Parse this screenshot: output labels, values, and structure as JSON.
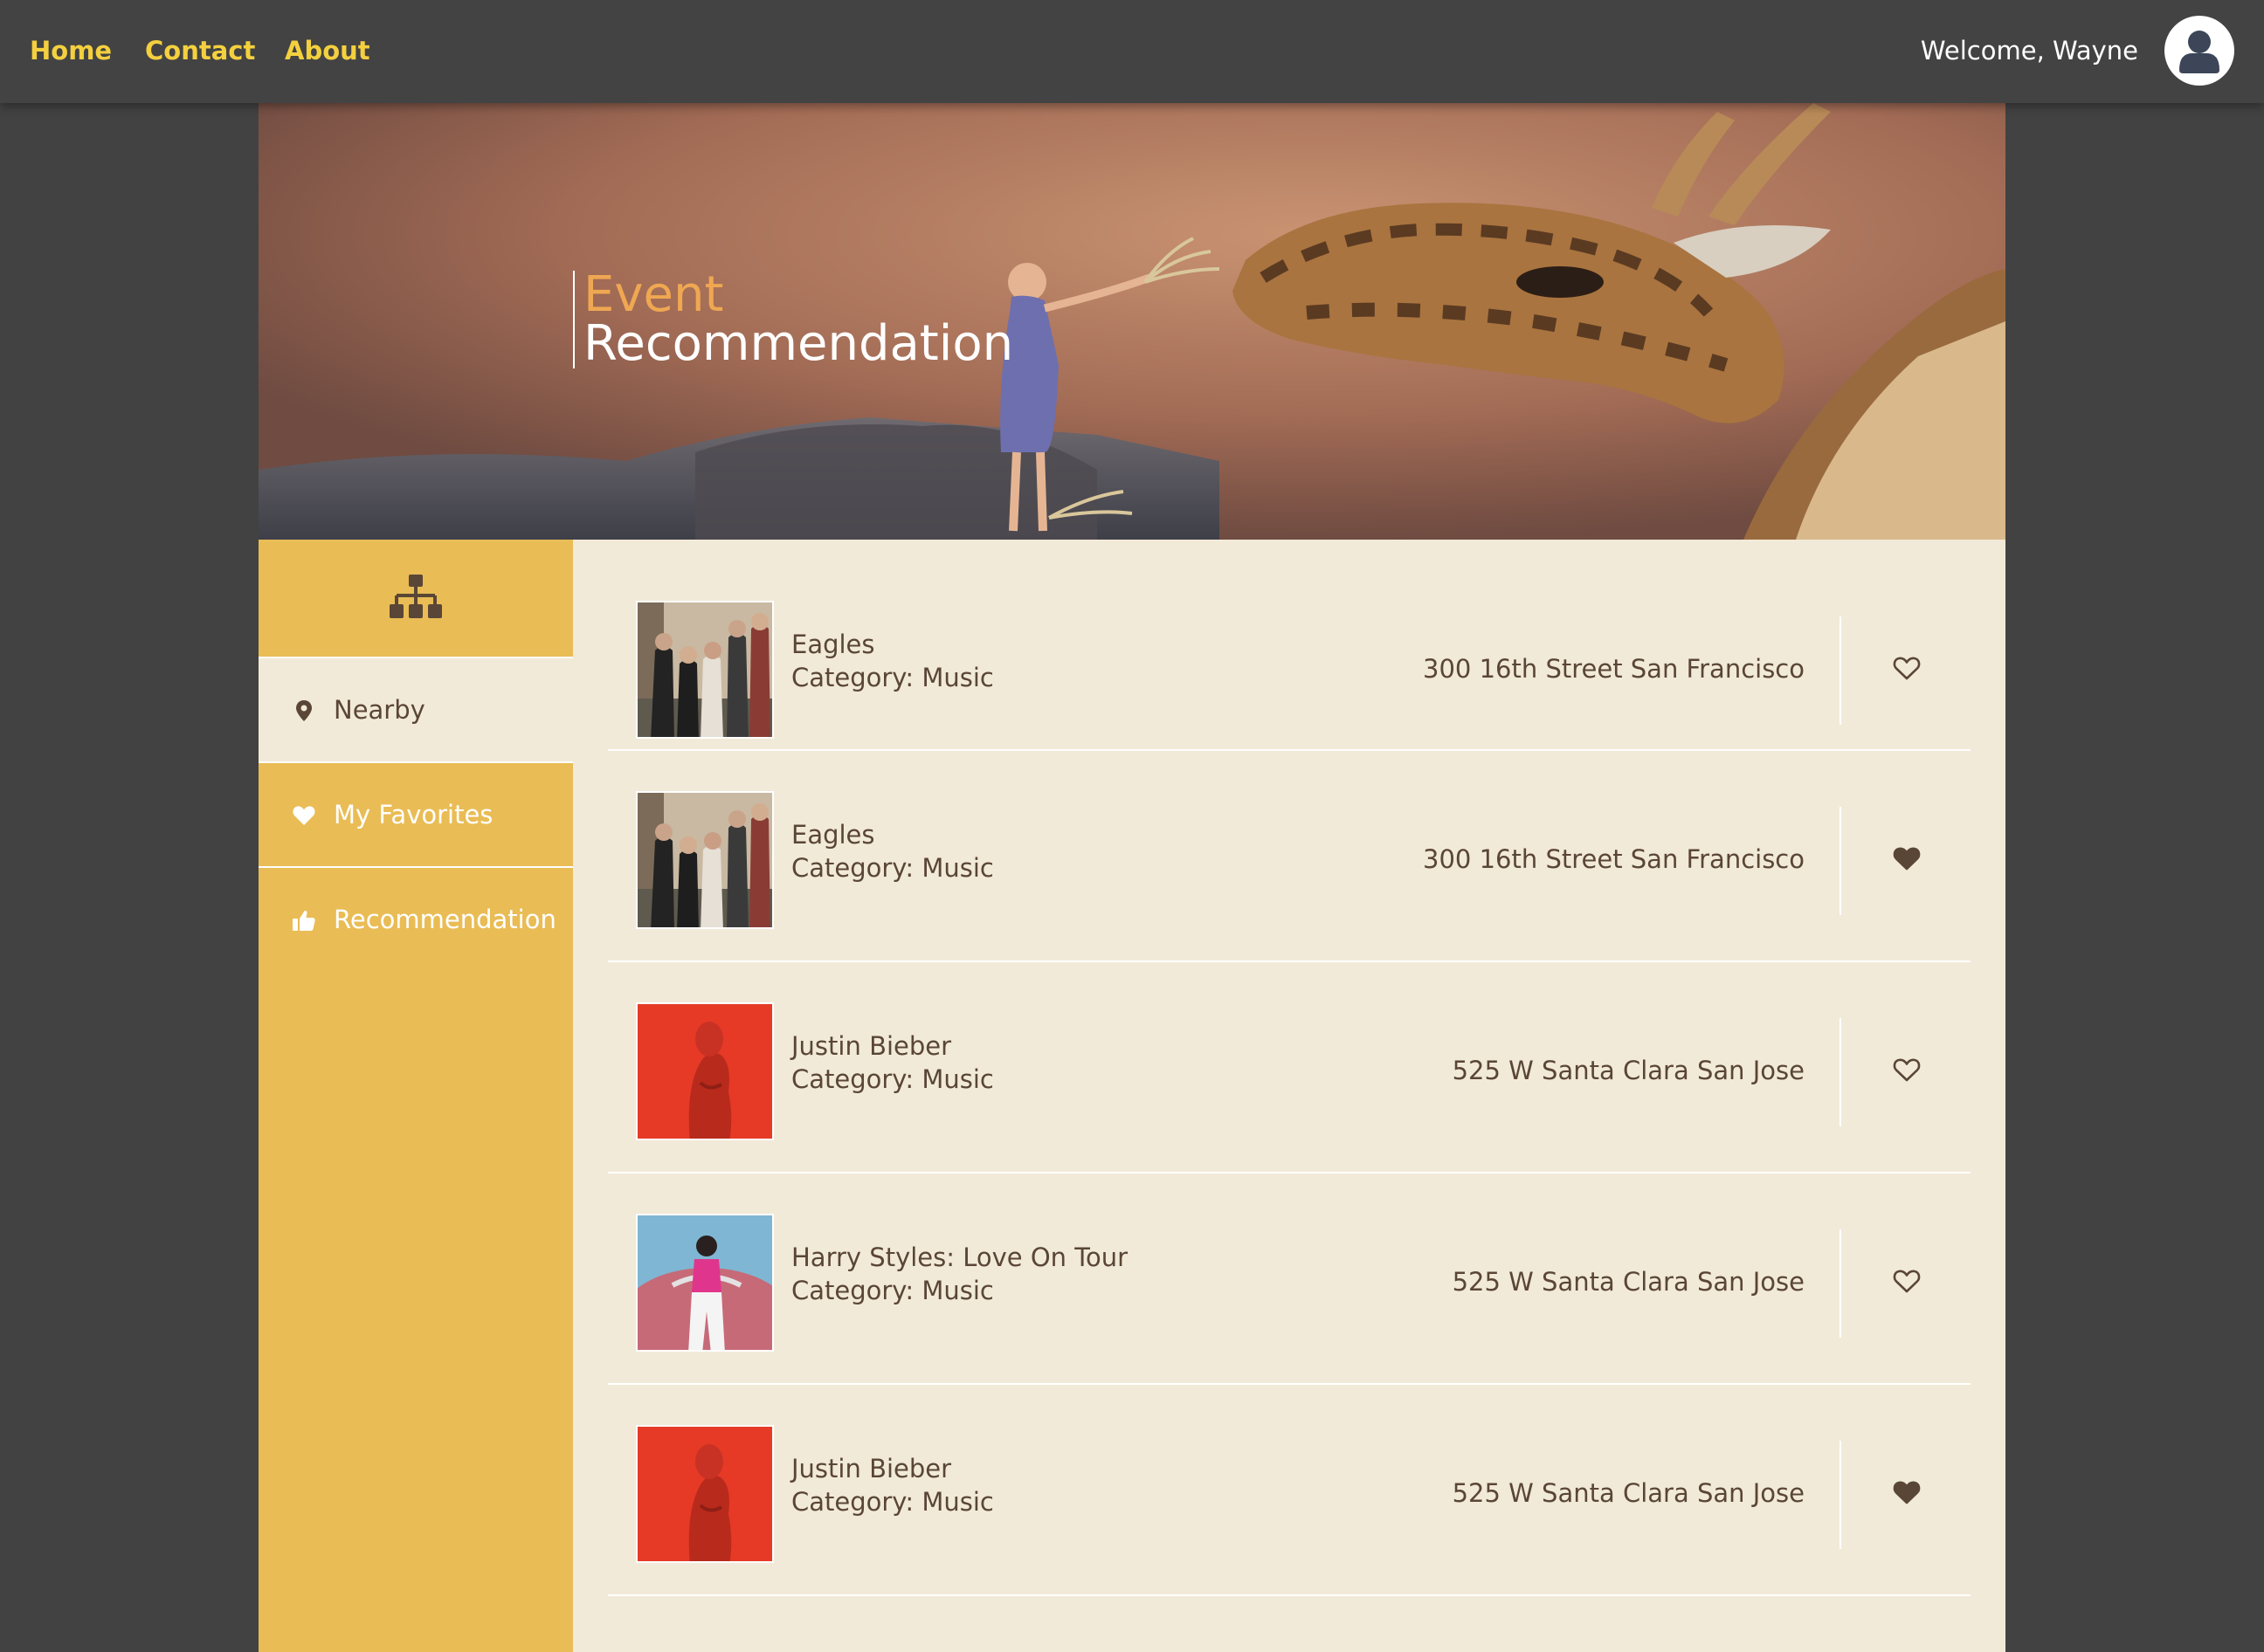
{
  "nav": {
    "home": "Home",
    "contact": "Contact",
    "about": "About",
    "welcome": "Welcome, Wayne"
  },
  "hero": {
    "title_line1": "Event",
    "title_line2": "Recommendation"
  },
  "sidebar": {
    "header_icon": "sitemap-icon",
    "items": [
      {
        "label": "Nearby",
        "icon": "map-pin-icon",
        "active": true
      },
      {
        "label": "My Favorites",
        "icon": "heart-icon",
        "active": false
      },
      {
        "label": "Recommendation",
        "icon": "thumbs-up-icon",
        "active": false
      }
    ]
  },
  "events": [
    {
      "name": "Eagles",
      "category": "Category: Music",
      "address": "300 16th Street San Francisco",
      "favorited": false
    },
    {
      "name": "Eagles",
      "category": "Category: Music",
      "address": "300 16th Street San Francisco",
      "favorited": true
    },
    {
      "name": "Justin Bieber",
      "category": "Category: Music",
      "address": "525 W Santa Clara San Jose",
      "favorited": false
    },
    {
      "name": "Harry Styles: Love On Tour",
      "category": "Category: Music",
      "address": "525 W Santa Clara San Jose",
      "favorited": false
    },
    {
      "name": "Justin Bieber",
      "category": "Category: Music",
      "address": "525 W Santa Clara San Jose",
      "favorited": true
    }
  ],
  "colors": {
    "nav_bg": "#434343",
    "nav_link": "#f4d03f",
    "sidebar_bg": "#e9bc55",
    "content_bg": "#f2ead8",
    "text_brown": "#5a4636",
    "hero_title_accent": "#efa752"
  }
}
